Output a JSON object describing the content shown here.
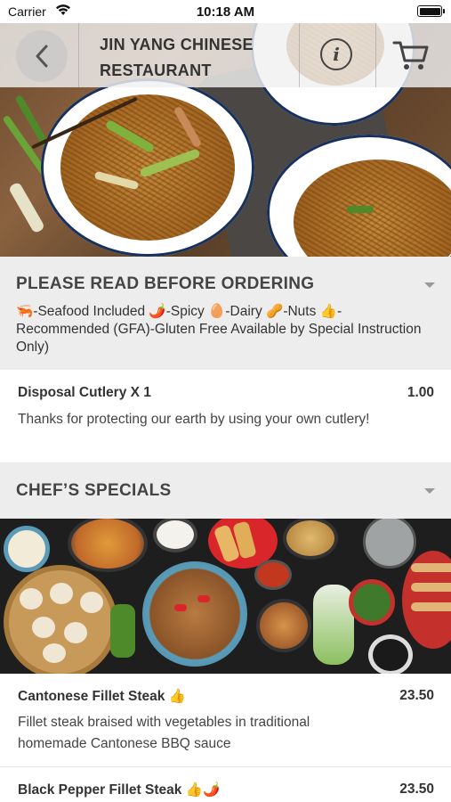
{
  "status_bar": {
    "carrier": "Carrier",
    "time": "10:18 AM"
  },
  "header": {
    "title": "JIN YANG CHINESE RESTAURANT",
    "icons": {
      "back": "chevron-left-icon",
      "info": "info-icon",
      "cart": "cart-icon"
    }
  },
  "notice_section": {
    "title": "PLEASE READ BEFORE ORDERING",
    "legend": "🦐-Seafood Included 🌶️-Spicy 🥚-Dairy 🥜-Nuts 👍-Recommended (GFA)-Gluten Free Available by Special Instruction Only)"
  },
  "cutlery_item": {
    "name": "Disposal Cutlery X 1",
    "price": "1.00",
    "description": "Thanks for protecting our earth by using your own cutlery!"
  },
  "specials_section": {
    "title": "CHEF’S SPECIALS",
    "items": [
      {
        "name": "Cantonese Fillet Steak 👍",
        "price": "23.50",
        "description": "Fillet steak braised with vegetables in traditional homemade Cantonese BBQ sauce"
      },
      {
        "name": "Black Pepper Fillet Steak 👍🌶️",
        "price": "23.50"
      }
    ]
  },
  "colors": {
    "section_header_bg": "#ededed",
    "plate_rim": "#17305c"
  }
}
